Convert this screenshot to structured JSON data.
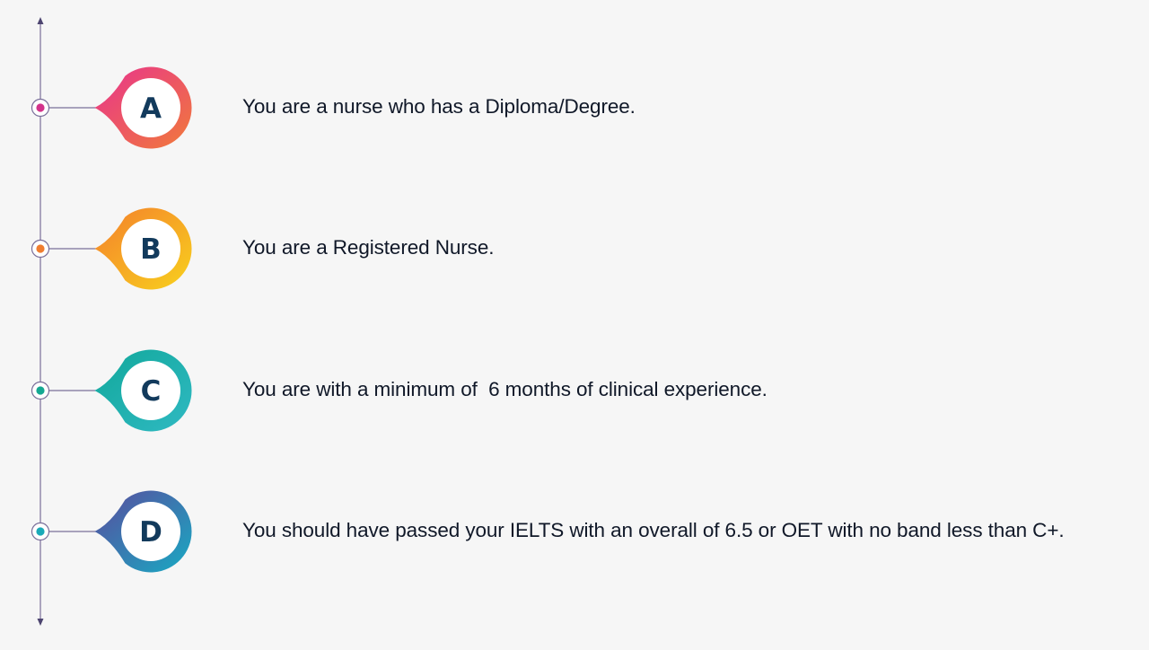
{
  "items": [
    {
      "letter": "A",
      "text": "You are a nurse who has a Diploma/Degree.",
      "gradient": [
        "#e8338e",
        "#f17a3a"
      ],
      "dot_color": "#d3338b"
    },
    {
      "letter": "B",
      "text": "You are a Registered Nurse.",
      "gradient": [
        "#f47f2c",
        "#f8d11d"
      ],
      "dot_color": "#f07d2f"
    },
    {
      "letter": "C",
      "text": "You are with a minimum of  6 months of clinical experience.",
      "gradient": [
        "#12a89b",
        "#2fb9c2"
      ],
      "dot_color": "#14a892"
    },
    {
      "letter": "D",
      "text": "You should have passed your IELTS with an overall of 6.5 or OET with no band less than C+.",
      "gradient": [
        "#5a4b9e",
        "#18aac3"
      ],
      "dot_color": "#1aaab8"
    }
  ],
  "colors": {
    "timeline_line": "#7a6f9a",
    "text": "#101828",
    "letter": "#123a5c",
    "background": "#f6f6f6"
  }
}
